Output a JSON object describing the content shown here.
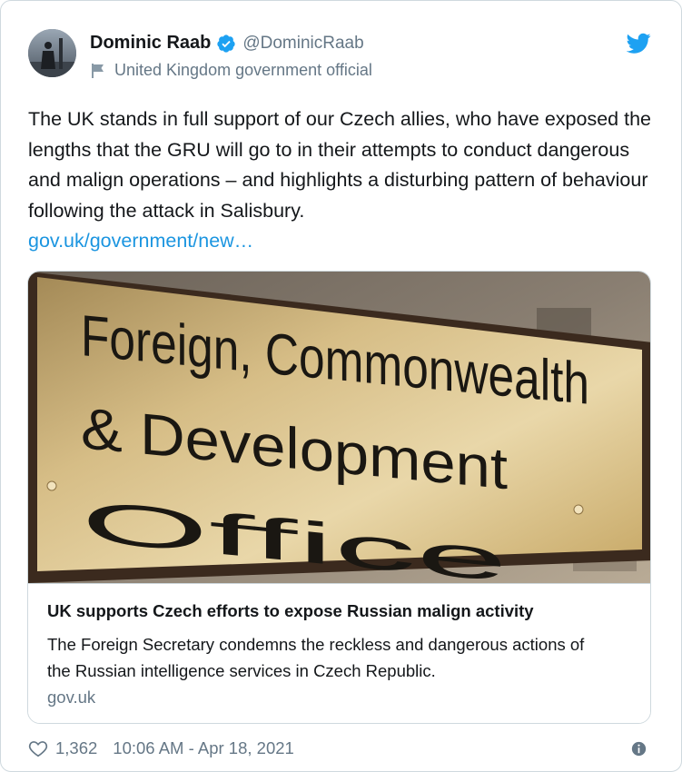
{
  "author": {
    "display_name": "Dominic Raab",
    "handle": "@DominicRaab",
    "label": "United Kingdom government official",
    "verified": true
  },
  "tweet": {
    "text": "The UK stands in full support of our Czech allies, who have exposed the lengths that the GRU will go to in their attempts to conduct dangerous and malign operations – and highlights a disturbing pattern of behaviour following the attack in Salisbury.",
    "link": "gov.uk/government/new…"
  },
  "card": {
    "image_sign_lines": [
      "Foreign, Commonwealth",
      "& Development Office"
    ],
    "title": "UK supports Czech efforts to expose Russian malign activity",
    "description": "The Foreign Secretary condemns the reckless and dangerous actions of the Russian intelligence services in Czech Republic.",
    "domain": "gov.uk"
  },
  "footer": {
    "likes": "1,362",
    "timestamp": "10:06 AM - Apr 18, 2021"
  },
  "colors": {
    "twitter_blue": "#1da1f2",
    "link_blue": "#1b95e0",
    "secondary_text": "#657786",
    "primary_text": "#14171a",
    "border": "#cfd9de"
  },
  "icons": [
    "twitter-bird-icon",
    "verified-badge-icon",
    "government-flag-icon",
    "heart-icon",
    "info-icon"
  ]
}
